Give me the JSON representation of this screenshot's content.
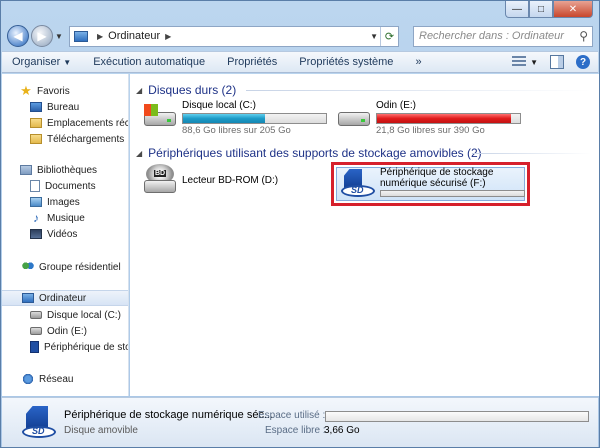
{
  "window": {
    "caption": {
      "minimize": "—",
      "maximize": "□",
      "close": "✕"
    }
  },
  "address": {
    "location": "Ordinateur",
    "search_placeholder": "Rechercher dans : Ordinateur"
  },
  "toolbar": {
    "organize": "Organiser",
    "autoplay": "Exécution automatique",
    "properties": "Propriétés",
    "system_properties": "Propriétés système",
    "more": "»"
  },
  "navpane": {
    "favorites": "Favoris",
    "desktop": "Bureau",
    "recent_places": "Emplacements réce",
    "downloads": "Téléchargements",
    "libraries": "Bibliothèques",
    "documents": "Documents",
    "images": "Images",
    "music": "Musique",
    "videos": "Vidéos",
    "homegroup": "Groupe résidentiel",
    "computer": "Ordinateur",
    "local_disk": "Disque local (C:)",
    "odin": "Odin (E:)",
    "sd_device": "Périphérique de stoc",
    "network": "Réseau"
  },
  "content": {
    "hard_disks_header": "Disques durs (2)",
    "removable_header": "Périphériques utilisant des supports de stockage amovibles (2)",
    "drives": [
      {
        "name": "Disque local (C:)",
        "free": "88,6 Go libres sur 205 Go",
        "used_fraction": 0.57
      },
      {
        "name": "Odin (E:)",
        "free": "21,8 Go libres sur 390 Go",
        "used_fraction": 0.94
      }
    ],
    "bd_rom": "Lecteur BD-ROM (D:)",
    "sd_name_line1": "Périphérique de stockage",
    "sd_name_line2": "numérique sécurisé (F:)",
    "sd_used_fraction": 0
  },
  "details": {
    "name": "Périphérique de stockage numérique séc...",
    "kind": "Disque amovible",
    "used_label": "Espace utilisé :",
    "free_label": "Espace libre :",
    "free_value": "3,66 Go",
    "used_fraction": 0
  },
  "colors": {
    "selection_highlight": "#d6202c",
    "bar_normal": "#1d9bc7",
    "bar_full": "#e01b1b",
    "group_header": "#1e3287"
  }
}
